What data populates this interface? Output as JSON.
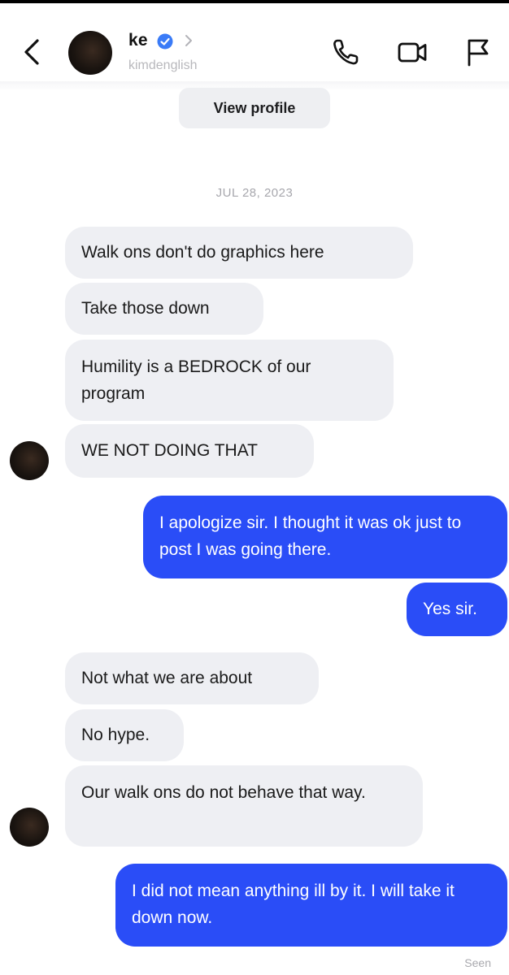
{
  "header": {
    "contact_name": "ke",
    "handle": "kimdenglish",
    "back_icon": "chevron-left-icon",
    "verified_icon": "verified-badge-icon",
    "verified_color": "#3a7bf7",
    "profile_chevron_icon": "chevron-right-icon",
    "actions": [
      "phone-icon",
      "video-camera-icon",
      "flag-icon"
    ]
  },
  "view_profile_label": "View profile",
  "date_label": "JUL 28, 2023",
  "colors": {
    "incoming_bubble": "#eeeff3",
    "outgoing_bubble": "#2a4df7"
  },
  "messages": [
    {
      "direction": "incoming",
      "text": "Walk ons don't do graphics here"
    },
    {
      "direction": "incoming",
      "text": "Take those down"
    },
    {
      "direction": "incoming",
      "text": "Humility is a BEDROCK of our program"
    },
    {
      "direction": "incoming",
      "text": "WE NOT DOING THAT"
    },
    {
      "direction": "outgoing",
      "text": "I apologize sir. I thought it was ok just to post I was going there."
    },
    {
      "direction": "outgoing",
      "text": "Yes sir."
    },
    {
      "direction": "incoming",
      "text": "Not what we are about"
    },
    {
      "direction": "incoming",
      "text": "No hype."
    },
    {
      "direction": "incoming",
      "text": "Our walk ons do not behave that way."
    },
    {
      "direction": "outgoing",
      "text": "I did not mean anything ill by it. I will take it down now."
    }
  ],
  "seen_label": "Seen"
}
